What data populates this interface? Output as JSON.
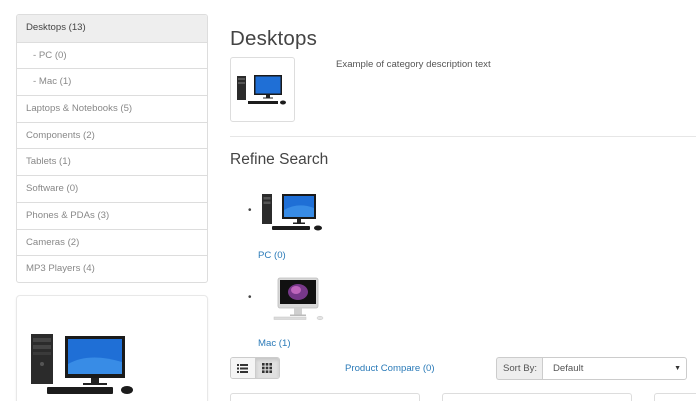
{
  "sidebar": {
    "categories": [
      {
        "label": "Desktops (13)",
        "active": true,
        "sub": false
      },
      {
        "label": "- PC (0)",
        "active": false,
        "sub": true
      },
      {
        "label": "- Mac (1)",
        "active": false,
        "sub": true
      },
      {
        "label": "Laptops & Notebooks (5)",
        "active": false,
        "sub": false
      },
      {
        "label": "Components (2)",
        "active": false,
        "sub": false
      },
      {
        "label": "Tablets (1)",
        "active": false,
        "sub": false
      },
      {
        "label": "Software (0)",
        "active": false,
        "sub": false
      },
      {
        "label": "Phones & PDAs (3)",
        "active": false,
        "sub": false
      },
      {
        "label": "Cameras (2)",
        "active": false,
        "sub": false
      },
      {
        "label": "MP3 Players (4)",
        "active": false,
        "sub": false
      }
    ]
  },
  "main": {
    "title": "Desktops",
    "description": "Example of category description text",
    "refine_title": "Refine Search",
    "refine_items": [
      {
        "label": "PC (0)",
        "bullet": "•",
        "image": "desktop-pc-icon"
      },
      {
        "label": "Mac (1)",
        "bullet": "•",
        "image": "imac-icon"
      }
    ]
  },
  "toolbar": {
    "list_view_icon": "list-icon",
    "grid_view_icon": "grid-icon",
    "compare_label": "Product Compare (0)",
    "sort_label": "Sort By:",
    "sort_value": "Default",
    "sort_caret": "▼"
  },
  "colors": {
    "link": "#2a7ab8",
    "active_bg": "#eeeeee",
    "border": "#dddddd",
    "monitor_blue": "#1f6fd6"
  }
}
